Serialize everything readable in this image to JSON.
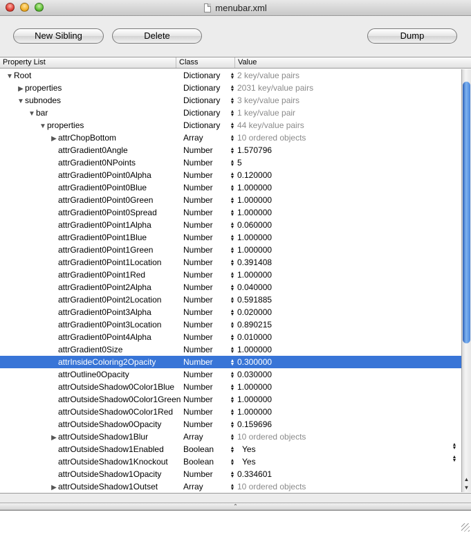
{
  "window": {
    "title": "menubar.xml"
  },
  "toolbar": {
    "new_sibling": "New Sibling",
    "delete": "Delete",
    "dump": "Dump"
  },
  "columns": {
    "property": "Property List",
    "class": "Class",
    "value": "Value"
  },
  "rows": [
    {
      "indent": 0,
      "disc": "open",
      "name": "Root",
      "cls": "Dictionary",
      "value": "2 key/value pairs",
      "muted": true
    },
    {
      "indent": 1,
      "disc": "closed",
      "name": "properties",
      "cls": "Dictionary",
      "value": "2031 key/value pairs",
      "muted": true
    },
    {
      "indent": 1,
      "disc": "open",
      "name": "subnodes",
      "cls": "Dictionary",
      "value": "3 key/value pairs",
      "muted": true
    },
    {
      "indent": 2,
      "disc": "open",
      "name": "bar",
      "cls": "Dictionary",
      "value": "1 key/value pair",
      "muted": true
    },
    {
      "indent": 3,
      "disc": "open",
      "name": "properties",
      "cls": "Dictionary",
      "value": "44 key/value pairs",
      "muted": true
    },
    {
      "indent": 4,
      "disc": "closed",
      "name": "attrChopBottom",
      "cls": "Array",
      "value": "10 ordered objects",
      "muted": true
    },
    {
      "indent": 4,
      "disc": "none",
      "name": "attrGradient0Angle",
      "cls": "Number",
      "value": "1.570796"
    },
    {
      "indent": 4,
      "disc": "none",
      "name": "attrGradient0NPoints",
      "cls": "Number",
      "value": "5"
    },
    {
      "indent": 4,
      "disc": "none",
      "name": "attrGradient0Point0Alpha",
      "cls": "Number",
      "value": "0.120000"
    },
    {
      "indent": 4,
      "disc": "none",
      "name": "attrGradient0Point0Blue",
      "cls": "Number",
      "value": "1.000000"
    },
    {
      "indent": 4,
      "disc": "none",
      "name": "attrGradient0Point0Green",
      "cls": "Number",
      "value": "1.000000"
    },
    {
      "indent": 4,
      "disc": "none",
      "name": "attrGradient0Point0Spread",
      "cls": "Number",
      "value": "1.000000"
    },
    {
      "indent": 4,
      "disc": "none",
      "name": "attrGradient0Point1Alpha",
      "cls": "Number",
      "value": "0.060000"
    },
    {
      "indent": 4,
      "disc": "none",
      "name": "attrGradient0Point1Blue",
      "cls": "Number",
      "value": "1.000000"
    },
    {
      "indent": 4,
      "disc": "none",
      "name": "attrGradient0Point1Green",
      "cls": "Number",
      "value": "1.000000"
    },
    {
      "indent": 4,
      "disc": "none",
      "name": "attrGradient0Point1Location",
      "cls": "Number",
      "value": "0.391408"
    },
    {
      "indent": 4,
      "disc": "none",
      "name": "attrGradient0Point1Red",
      "cls": "Number",
      "value": "1.000000"
    },
    {
      "indent": 4,
      "disc": "none",
      "name": "attrGradient0Point2Alpha",
      "cls": "Number",
      "value": "0.040000"
    },
    {
      "indent": 4,
      "disc": "none",
      "name": "attrGradient0Point2Location",
      "cls": "Number",
      "value": "0.591885"
    },
    {
      "indent": 4,
      "disc": "none",
      "name": "attrGradient0Point3Alpha",
      "cls": "Number",
      "value": "0.020000"
    },
    {
      "indent": 4,
      "disc": "none",
      "name": "attrGradient0Point3Location",
      "cls": "Number",
      "value": "0.890215"
    },
    {
      "indent": 4,
      "disc": "none",
      "name": "attrGradient0Point4Alpha",
      "cls": "Number",
      "value": "0.010000"
    },
    {
      "indent": 4,
      "disc": "none",
      "name": "attrGradient0Size",
      "cls": "Number",
      "value": "1.000000"
    },
    {
      "indent": 4,
      "disc": "none",
      "name": "attrInsideColoring2Opacity",
      "cls": "Number",
      "value": "0.300000",
      "selected": true
    },
    {
      "indent": 4,
      "disc": "none",
      "name": "attrOutline0Opacity",
      "cls": "Number",
      "value": "0.030000"
    },
    {
      "indent": 4,
      "disc": "none",
      "name": "attrOutsideShadow0Color1Blue",
      "cls": "Number",
      "value": "1.000000"
    },
    {
      "indent": 4,
      "disc": "none",
      "name": "attrOutsideShadow0Color1Green",
      "cls": "Number",
      "value": "1.000000"
    },
    {
      "indent": 4,
      "disc": "none",
      "name": "attrOutsideShadow0Color1Red",
      "cls": "Number",
      "value": "1.000000"
    },
    {
      "indent": 4,
      "disc": "none",
      "name": "attrOutsideShadow0Opacity",
      "cls": "Number",
      "value": "0.159696"
    },
    {
      "indent": 4,
      "disc": "closed",
      "name": "attrOutsideShadow1Blur",
      "cls": "Array",
      "value": "10 ordered objects",
      "muted": true
    },
    {
      "indent": 4,
      "disc": "none",
      "name": "attrOutsideShadow1Enabled",
      "cls": "Boolean",
      "value": "Yes",
      "popup": true
    },
    {
      "indent": 4,
      "disc": "none",
      "name": "attrOutsideShadow1Knockout",
      "cls": "Boolean",
      "value": "Yes",
      "popup": true
    },
    {
      "indent": 4,
      "disc": "none",
      "name": "attrOutsideShadow1Opacity",
      "cls": "Number",
      "value": "0.334601"
    },
    {
      "indent": 4,
      "disc": "closed",
      "name": "attrOutsideShadow1Outset",
      "cls": "Array",
      "value": "10 ordered objects",
      "muted": true
    }
  ],
  "colors": {
    "selection": "#3875d7",
    "muted_text": "#8a8a8a",
    "scroll_thumb": "#4a86dc"
  }
}
